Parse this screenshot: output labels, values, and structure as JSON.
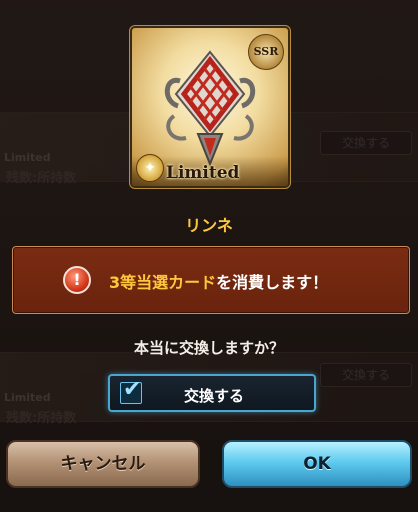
{
  "background": {
    "tag_1": "Limited",
    "tag_2": "Limited",
    "row_1_text": "残数:所持数",
    "row_2_text": "残数:所持数",
    "row_1_button": "交換する",
    "row_2_button": "交換する"
  },
  "card": {
    "rarity_badge": "SSR",
    "limited_label": "Limited",
    "emblem_icon": "endless-knot-icon"
  },
  "character_name": "リンネ",
  "warning": {
    "icon": "exclamation-icon",
    "highlight": "3等当選カード",
    "text": "を消費します！"
  },
  "question": "本当に交換しますか？",
  "exchange_checkbox": {
    "checked": true,
    "label": "交換する"
  },
  "buttons": {
    "cancel": "キャンセル",
    "ok": "OK"
  },
  "colors": {
    "name_gold": "#ffc83c",
    "warning_bg": "#7a2c12",
    "ok_blue": "#5fcbef",
    "cancel_tan": "#b39275"
  }
}
